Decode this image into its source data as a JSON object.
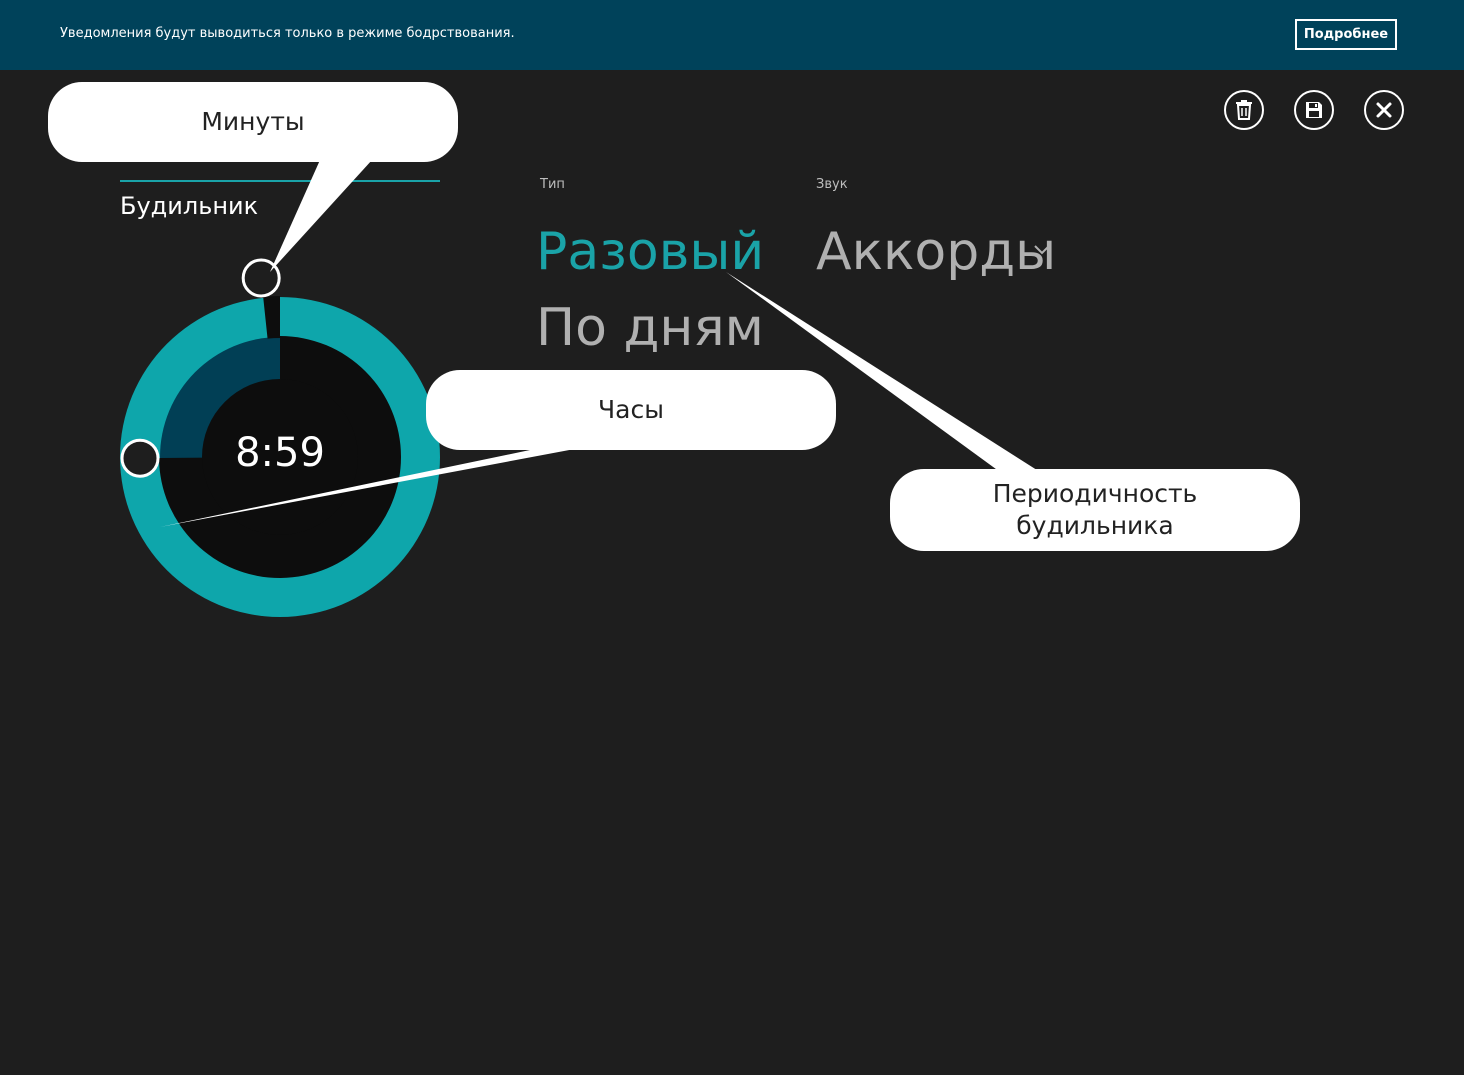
{
  "notification": {
    "message": "Уведомления будут выводиться только в режиме бодрствования.",
    "more_button": "Подробнее"
  },
  "app_bar": {
    "icons": [
      "trash-icon",
      "save-icon",
      "close-icon"
    ]
  },
  "alarm": {
    "name": "Будильник",
    "time": "8:59",
    "hours": 8,
    "minutes": 59
  },
  "type_field": {
    "label": "Тип",
    "options": [
      "Разовый",
      "По дням"
    ],
    "selected": "Разовый"
  },
  "sound_field": {
    "label": "Звук",
    "value": "Аккорды"
  },
  "callouts": {
    "minutes": "Минуты",
    "hours": "Часы",
    "frequency_line1": "Периодичность",
    "frequency_line2": "будильника"
  },
  "colors": {
    "accent": "#1aa3a8",
    "notification_bar": "#00425a",
    "background": "#1e1e1e",
    "hour_ring": "#013f55"
  }
}
